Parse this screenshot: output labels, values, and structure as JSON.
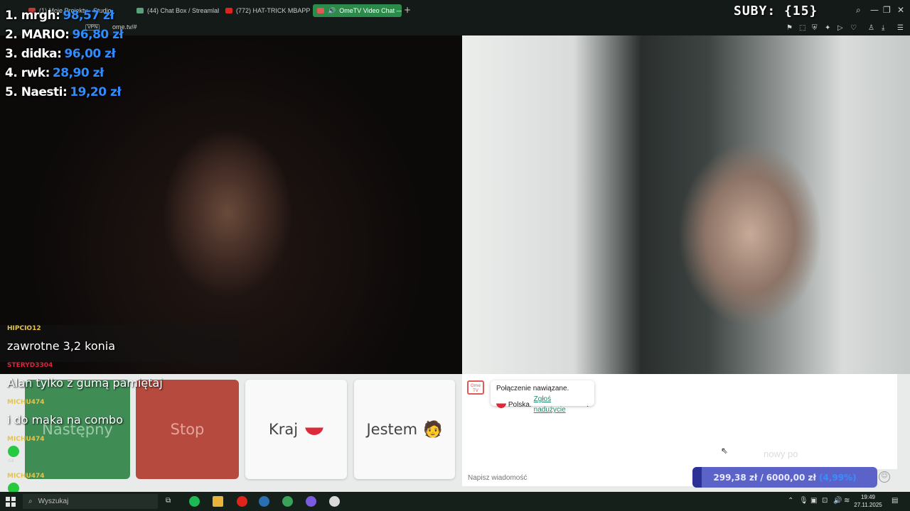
{
  "browser": {
    "tabs": [
      {
        "label": "(1) Moje Projekty - Studio",
        "color": "#c03a3a"
      },
      {
        "label": "(44) Chat Box / Streamlabs",
        "color": "#5aa07a"
      },
      {
        "label": "(772) HAT-TRICK MBAPPE",
        "color": "#e0241b"
      },
      {
        "label": "OmeTV Video Chat —",
        "color": "#e05a55",
        "active": true
      }
    ],
    "new_tab": "+",
    "vpn_label": "VPN",
    "url": "ome.tv/#"
  },
  "overlay": {
    "subs_label": "SUBY: {15}",
    "ranking": [
      {
        "name": "1. mrgh:",
        "amount": "98,57 zł"
      },
      {
        "name": "2. MARIO:",
        "amount": "96,80 zł"
      },
      {
        "name": "3. didka:",
        "amount": "96,00 zł"
      },
      {
        "name": "4. rwk:",
        "amount": "28,90 zł"
      },
      {
        "name": "5. Naesti:",
        "amount": "19,20 zł"
      }
    ]
  },
  "stream_chat": [
    {
      "user": "HIPCIO12",
      "user_color": "#e8c34a",
      "text": "zawrotne 3,2 konia"
    },
    {
      "user": "STERYD3304",
      "user_color": "#e0243a",
      "text": "Alan tylko z gumą pamiętaj"
    },
    {
      "user": "MICHU474",
      "user_color": "#e8c34a",
      "text": "i do maka na combo"
    },
    {
      "user": "MICHU474",
      "user_color": "#e8c34a",
      "text": ""
    },
    {
      "user": "MICHU474",
      "user_color": "#e8c34a",
      "text": ""
    }
  ],
  "chat_badge_label": "GX",
  "controls": {
    "next_label": "Następny",
    "stop_label": "Stop",
    "country_label": "Kraj",
    "me_label": "Jestem",
    "me_emoji": "🧑"
  },
  "ome_chat": {
    "logo_text": "Ome TV",
    "connected_text": "Połączenie nawiązane.",
    "country_text": "Polska.",
    "report_link": "Zgłoś nadużycie",
    "report_suffix": ".",
    "ghost_text": "nowy po",
    "input_placeholder": "Napisz wiadomość"
  },
  "goal": {
    "current": "299,38 zł",
    "separator": "/",
    "target": "6000,00 zł",
    "percent_label": "(4,99%)",
    "percent_value": 4.99
  },
  "taskbar": {
    "search_placeholder": "Wyszukaj",
    "time": "19:49",
    "date": "27.11.2025"
  }
}
